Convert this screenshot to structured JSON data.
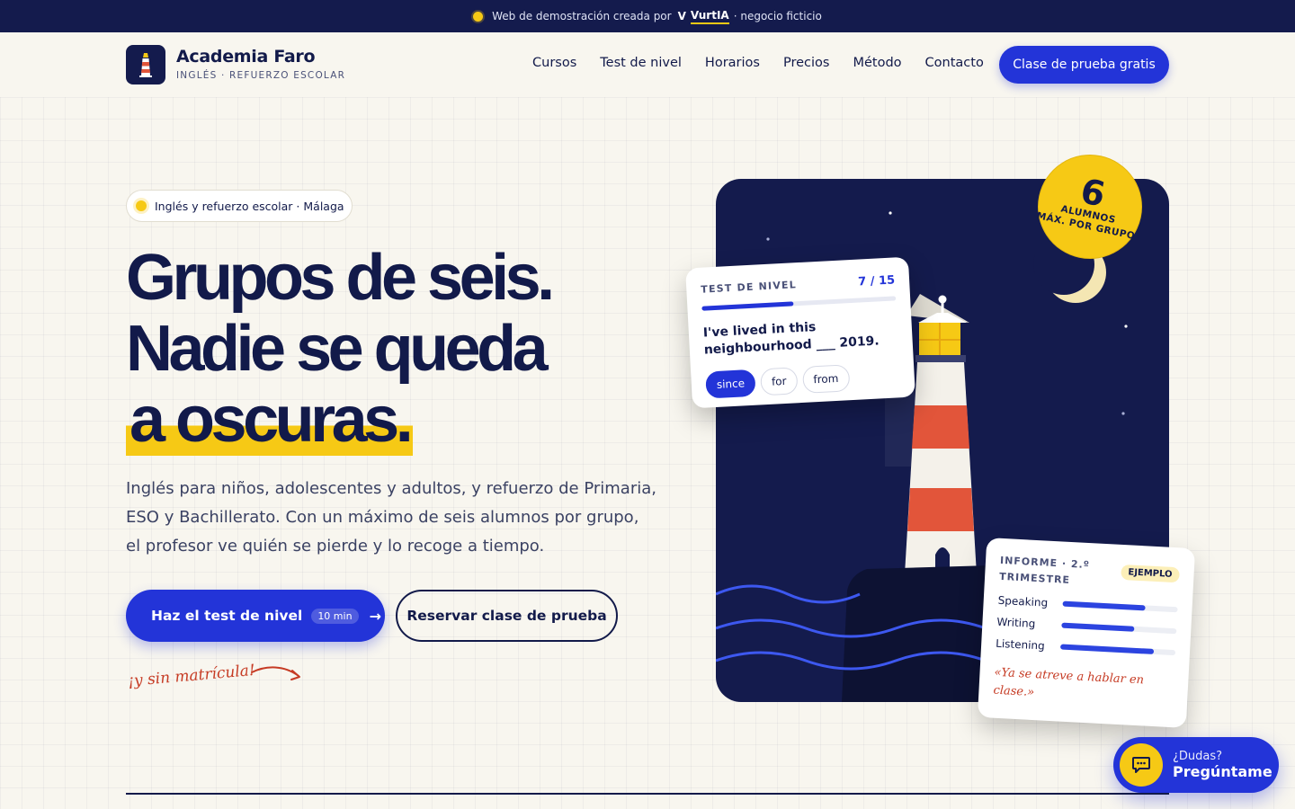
{
  "topbar": {
    "text": "Web de demostración creada por",
    "brand": "VurtIA",
    "suffix": "· negocio ficticio"
  },
  "header": {
    "logo_title": "Academia Faro",
    "logo_subtitle": "INGLÉS · REFUERZO ESCOLAR",
    "nav": [
      "Cursos",
      "Test de nivel",
      "Horarios",
      "Precios",
      "Método",
      "Contacto"
    ],
    "cta": "Clase de prueba gratis"
  },
  "hero": {
    "pill": "Inglés y refuerzo escolar · Málaga",
    "headline_1": "Grupos de seis.",
    "headline_2": "Nadie se queda",
    "headline_3": "a oscuras.",
    "lede": "Inglés para niños, adolescentes y adultos, y refuerzo de Primaria, ESO y Bachillerato. Con un máximo de seis alumnos por grupo, el profesor ve quién se pierde y lo recoge a tiempo.",
    "primary_button": "Haz el test de nivel",
    "primary_badge": "10 min",
    "secondary_button": "Reservar clase de prueba",
    "script_note": "¡y sin matrícula!"
  },
  "badge": {
    "number": "6",
    "line1": "ALUMNOS",
    "line2": "MÁX. POR GRUPO"
  },
  "test_card": {
    "title": "TEST DE NIVEL",
    "progress_label": "7 / 15",
    "progress": 0.47,
    "question": "I've lived in this neighbourhood ___ 2019.",
    "options": [
      "since",
      "for",
      "from"
    ],
    "selected": "since"
  },
  "report_card": {
    "title": "INFORME · 2.º TRIMESTRE",
    "tag": "EJEMPLO",
    "skills": [
      {
        "label": "Speaking",
        "level": 0.72
      },
      {
        "label": "Writing",
        "level": 0.63
      },
      {
        "label": "Listening",
        "level": 0.81
      }
    ],
    "quote": "«Ya se atreve a hablar en clase.»"
  },
  "chat": {
    "line1": "¿Dudas?",
    "line2": "Pregúntame"
  },
  "colors": {
    "navy": "#141b4d",
    "blue": "#2334d8",
    "yellow": "#f6c915",
    "red": "#e2553a",
    "background": "#f8f6ef"
  }
}
